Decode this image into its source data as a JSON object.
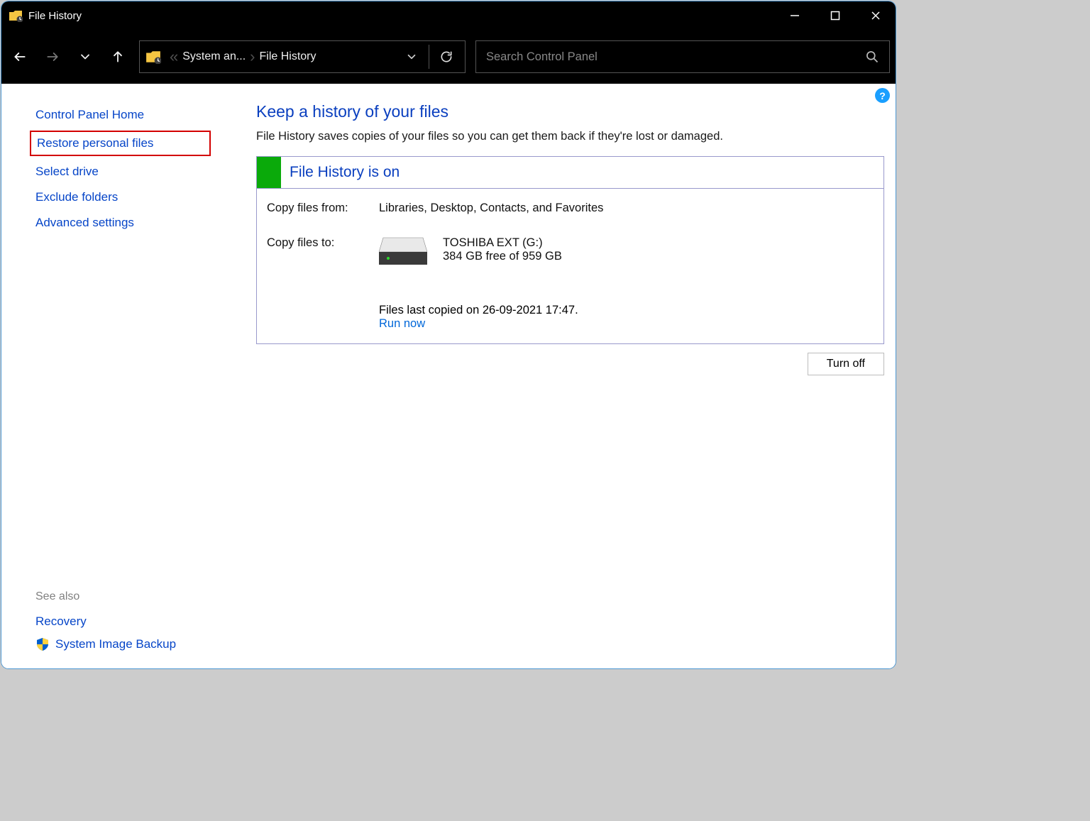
{
  "titlebar": {
    "title": "File History"
  },
  "breadcrumb": {
    "ellipsis": "«",
    "seg1": "System an...",
    "seg2": "File History"
  },
  "search": {
    "placeholder": "Search Control Panel"
  },
  "sidebar": {
    "home": "Control Panel Home",
    "restore": "Restore personal files",
    "select_drive": "Select drive",
    "exclude": "Exclude folders",
    "advanced": "Advanced settings",
    "see_also": "See also",
    "recovery": "Recovery",
    "system_image": "System Image Backup"
  },
  "main": {
    "heading": "Keep a history of your files",
    "subtitle": "File History saves copies of your files so you can get them back if they're lost or damaged.",
    "status_title": "File History is on",
    "from_label": "Copy files from:",
    "from_value": "Libraries, Desktop, Contacts, and Favorites",
    "to_label": "Copy files to:",
    "drive_name": "TOSHIBA EXT (G:)",
    "drive_space": "384 GB free of 959 GB",
    "last_copied": "Files last copied on 26-09-2021 17:47.",
    "run_now": "Run now",
    "turn_off": "Turn off"
  }
}
